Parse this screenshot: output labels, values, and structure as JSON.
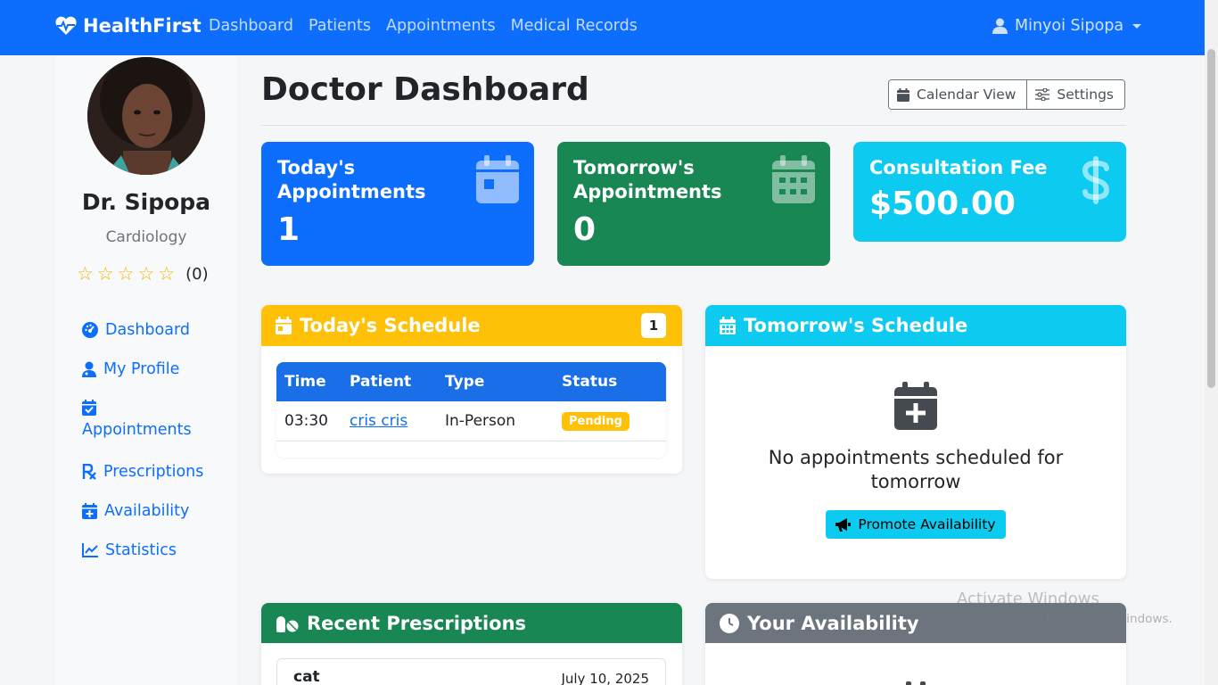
{
  "navbar": {
    "brand": "HealthFirst",
    "links": [
      "Dashboard",
      "Patients",
      "Appointments",
      "Medical Records"
    ],
    "user": "Minyoi Sipopa"
  },
  "sidebar": {
    "doctor_name": "Dr. Sipopa",
    "specialty": "Cardiology",
    "rating_count": "(0)",
    "stars": 5,
    "items": [
      {
        "label": "Dashboard",
        "icon": "gauge-icon"
      },
      {
        "label": "My Profile",
        "icon": "user-doctor-icon"
      },
      {
        "label": "Appointments",
        "icon": "calendar-check-icon"
      },
      {
        "label": "Prescriptions",
        "icon": "prescription-icon"
      },
      {
        "label": "Availability",
        "icon": "calendar-plus-icon"
      },
      {
        "label": "Statistics",
        "icon": "chart-line-icon"
      }
    ]
  },
  "header": {
    "title": "Doctor Dashboard",
    "calendar_view": "Calendar View",
    "settings": "Settings"
  },
  "stats": {
    "today": {
      "label": "Today's Appointments",
      "value": "1",
      "color": "#0d6efd"
    },
    "tomorrow": {
      "label": "Tomorrow's Appointments",
      "value": "0",
      "color": "#198754"
    },
    "fee": {
      "label": "Consultation Fee",
      "value": "$500.00",
      "color": "#0dcaf0"
    }
  },
  "today_schedule": {
    "title": "Today's Schedule",
    "count": "1",
    "columns": [
      "Time",
      "Patient",
      "Type",
      "Status"
    ],
    "rows": [
      {
        "time": "03:30",
        "patient": "cris cris",
        "type": "In-Person",
        "status": "Pending"
      }
    ]
  },
  "tomorrow_schedule": {
    "title": "Tomorrow's Schedule",
    "empty_text": "No appointments scheduled for tomorrow",
    "button": "Promote Availability"
  },
  "recent_prescriptions": {
    "title": "Recent Prescriptions",
    "items": [
      {
        "name": "cat",
        "date": "July 10, 2025"
      }
    ]
  },
  "availability": {
    "title": "Your Availability"
  },
  "watermark": {
    "line1": "Activate Windows",
    "line2": "Go to Settings to activate Windows."
  }
}
